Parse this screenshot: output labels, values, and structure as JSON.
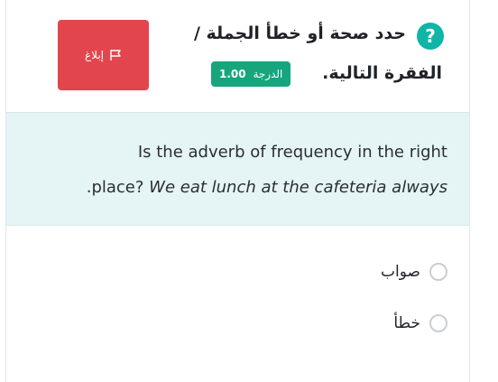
{
  "header": {
    "title_line1": "حدد صحة أو خطأ الجملة /",
    "title_line2": "الفقرة التالية.",
    "grade_label": "الدرجة",
    "grade_value": "1.00",
    "report_label": "إبلاغ",
    "help_icon": "question-circle-icon",
    "help_symbol": "?",
    "report_icon": "flag-icon",
    "colors": {
      "report": "#e3454d",
      "grade": "#16a57d",
      "help": "#0fb5a6",
      "question_bg": "#e5f4f5"
    }
  },
  "question": {
    "line1": "Is the adverb of frequency in the right",
    "line2_prefix": ".place? ",
    "line2_italic": "We eat lunch at the cafeteria always"
  },
  "options": [
    {
      "label": "صواب",
      "selected": false
    },
    {
      "label": "خطأ",
      "selected": false
    }
  ]
}
